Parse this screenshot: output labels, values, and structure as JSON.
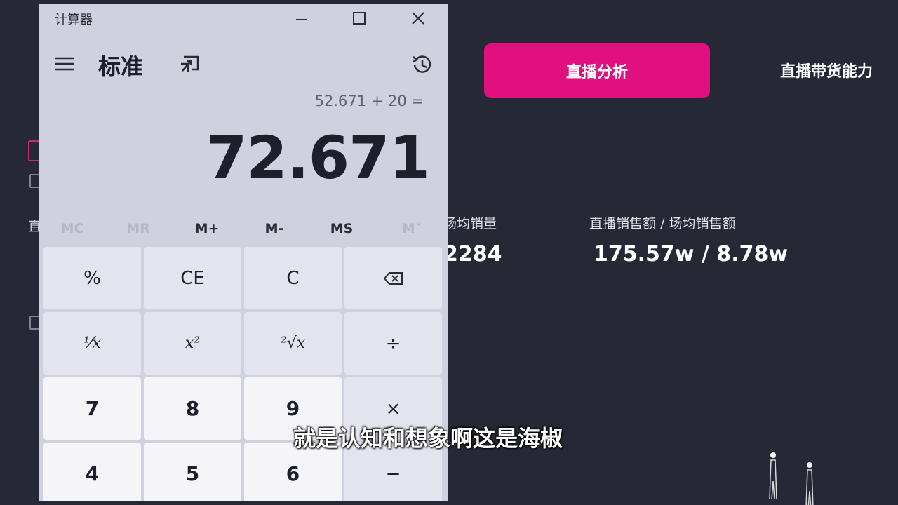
{
  "background": {
    "active_tab_label": "直播分析",
    "tab_label": "直播带货能力",
    "metric_partial_label": "场均销量",
    "metric_partial_value": "2284",
    "metric_label": "直播销售额 / 场均销售额",
    "metric_value": "175.57w / 8.78w",
    "fragment_text": "直"
  },
  "calculator": {
    "window_title": "计算器",
    "mode_title": "标准",
    "expression": "52.671 + 20 =",
    "display": "72.671",
    "memory": {
      "mc": "MC",
      "mr": "MR",
      "mplus": "M+",
      "mminus": "M-",
      "ms": "MS",
      "mlist": "M˅"
    },
    "keys": {
      "percent": "%",
      "ce": "CE",
      "c": "C",
      "reciprocal": "¹⁄x",
      "square": "x²",
      "sqrt": "²√x",
      "divide": "÷",
      "seven": "7",
      "eight": "8",
      "nine": "9",
      "multiply": "×",
      "four": "4",
      "five": "5",
      "six": "6",
      "minus": "−"
    }
  },
  "subtitle": "就是认知和想象啊这是海椒"
}
